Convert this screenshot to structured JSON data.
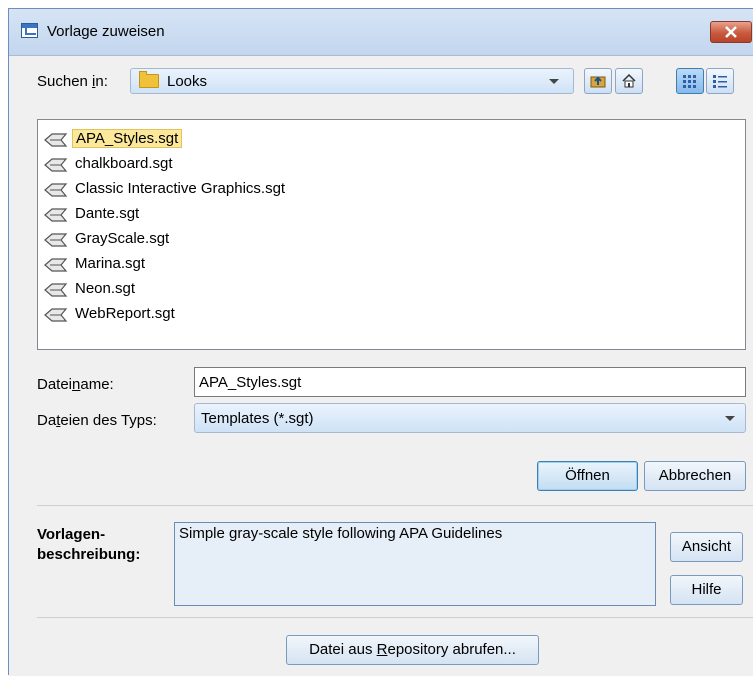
{
  "window": {
    "title": "Vorlage zuweisen"
  },
  "look_in": {
    "label_prefix": "Suchen ",
    "label_accel": "i",
    "label_suffix": "n:",
    "value": "Looks"
  },
  "files": [
    {
      "name": "APA_Styles.sgt",
      "selected": true
    },
    {
      "name": "chalkboard.sgt",
      "selected": false
    },
    {
      "name": "Classic Interactive Graphics.sgt",
      "selected": false
    },
    {
      "name": "Dante.sgt",
      "selected": false
    },
    {
      "name": "GrayScale.sgt",
      "selected": false
    },
    {
      "name": "Marina.sgt",
      "selected": false
    },
    {
      "name": "Neon.sgt",
      "selected": false
    },
    {
      "name": "WebReport.sgt",
      "selected": false
    }
  ],
  "filename": {
    "label_prefix": "Datei",
    "label_accel": "n",
    "label_suffix": "ame:",
    "value": "APA_Styles.sgt"
  },
  "filetype": {
    "label_prefix": "Da",
    "label_accel": "t",
    "label_suffix": "eien des Typs:",
    "value": "Templates (*.sgt)"
  },
  "buttons": {
    "open": "Öffnen",
    "cancel": "Abbrechen",
    "view": "Ansicht",
    "help": "Hilfe",
    "repo_prefix": "Datei aus ",
    "repo_accel": "R",
    "repo_suffix": "epository abrufen..."
  },
  "description": {
    "label_line1": "Vorlagen-",
    "label_line2": "beschreibung:",
    "text": "Simple gray-scale style following APA Guidelines"
  },
  "colors": {
    "selection": "#fbe89b",
    "accent": "#3c7fb1",
    "close": "#c85a3e"
  }
}
